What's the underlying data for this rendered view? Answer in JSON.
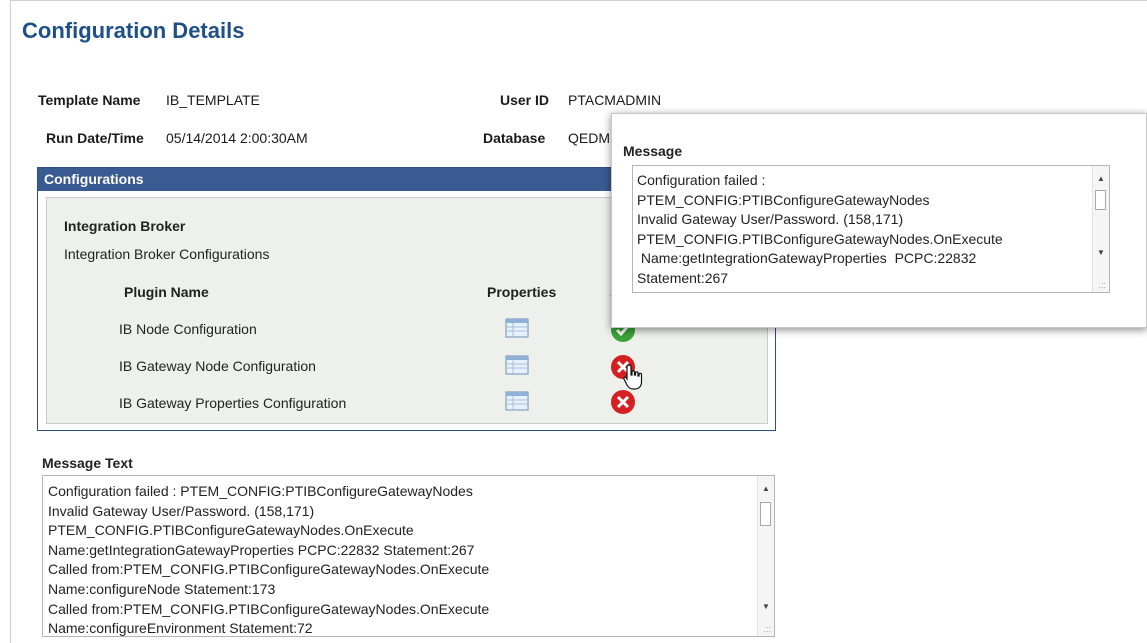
{
  "page": {
    "title": "Configuration Details"
  },
  "header": {
    "template_label": "Template Name",
    "template_value": "IB_TEMPLATE",
    "run_label": "Run Date/Time",
    "run_value": "05/14/2014  2:00:30AM",
    "user_label": "User ID",
    "user_value": "PTACMADMIN",
    "database_label": "Database",
    "database_value": "QEDM"
  },
  "configurations": {
    "title": "Configurations",
    "section_title": "Integration Broker",
    "section_subtitle": "Integration Broker Configurations",
    "columns": {
      "plugin": "Plugin Name",
      "properties": "Properties",
      "status": "S"
    },
    "rows": [
      {
        "name": "IB Node Configuration",
        "status": "success",
        "icon": "table-icon",
        "status_icon": "check-circle-icon"
      },
      {
        "name": "IB Gateway Node Configuration",
        "status": "error",
        "icon": "table-icon",
        "status_icon": "error-circle-icon"
      },
      {
        "name": "IB Gateway Properties Configuration",
        "status": "error",
        "icon": "table-icon",
        "status_icon": "error-circle-icon"
      }
    ],
    "colors": {
      "header_bg": "#3a5a92",
      "success": "#3aa33a",
      "error": "#d42020"
    }
  },
  "message_text": {
    "label": "Message Text",
    "lines": [
      "Configuration failed : PTEM_CONFIG:PTIBConfigureGatewayNodes",
      "Invalid Gateway User/Password. (158,171)",
      "PTEM_CONFIG.PTIBConfigureGatewayNodes.OnExecute",
      "Name:getIntegrationGatewayProperties  PCPC:22832  Statement:267",
      "Called from:PTEM_CONFIG.PTIBConfigureGatewayNodes.OnExecute",
      "Name:configureNode  Statement:173",
      "Called from:PTEM_CONFIG.PTIBConfigureGatewayNodes.OnExecute",
      "Name:configureEnvironment  Statement:72"
    ]
  },
  "popup": {
    "title": "Message",
    "lines": [
      "Configuration failed :",
      "PTEM_CONFIG:PTIBConfigureGatewayNodes",
      "Invalid Gateway User/Password. (158,171)",
      "PTEM_CONFIG.PTIBConfigureGatewayNodes.OnExecute",
      " Name:getIntegrationGatewayProperties  PCPC:22832",
      "Statement:267"
    ]
  }
}
